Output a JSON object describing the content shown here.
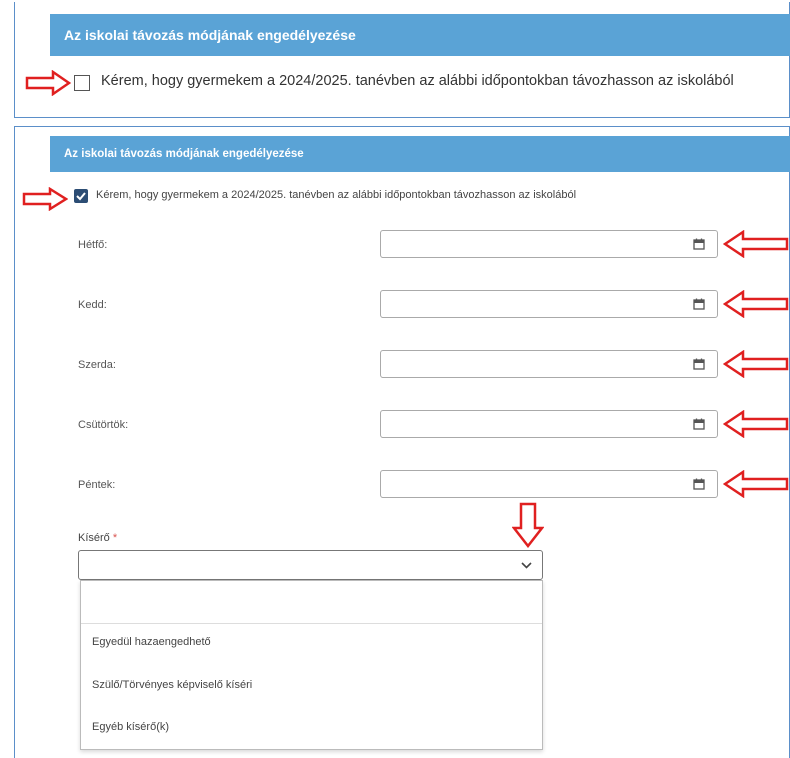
{
  "section1": {
    "title": "Az iskolai távozás módjának engedélyezése",
    "checkbox_label": "Kérem, hogy gyermekem a 2024/2025. tanévben az alábbi időpontokban távozhasson az iskolából",
    "checked": false
  },
  "section2": {
    "title": "Az iskolai távozás módjának engedélyezése",
    "checkbox_label": "Kérem, hogy gyermekem a 2024/2025. tanévben az alábbi időpontokban távozhasson az iskolából",
    "checked": true,
    "days": [
      {
        "label": "Hétfő:",
        "value": ""
      },
      {
        "label": "Kedd:",
        "value": ""
      },
      {
        "label": "Szerda:",
        "value": ""
      },
      {
        "label": "Csütörtök:",
        "value": ""
      },
      {
        "label": "Péntek:",
        "value": ""
      }
    ],
    "kisero": {
      "label": "Kísérő",
      "required_mark": "*",
      "value": "",
      "options": [
        "",
        "Egyedül hazaengedhető",
        "Szülő/Törvényes képviselő kíséri",
        "Egyéb kísérő(k)"
      ]
    }
  },
  "colors": {
    "header_bg": "#5aa3d6",
    "checkbox_checked": "#2c4d74",
    "annotation_arrow": "#e02020",
    "panel_border": "#5b8fc9"
  },
  "icons": [
    "arrow-right-icon",
    "arrow-left-icon",
    "arrow-down-icon",
    "calendar-icon",
    "chevron-down-icon",
    "checkmark-icon"
  ]
}
